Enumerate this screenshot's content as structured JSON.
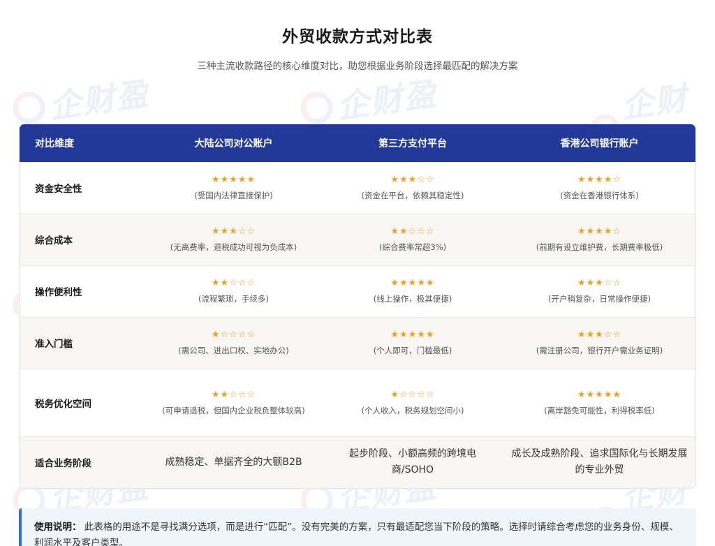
{
  "page": {
    "title": "外贸收款方式对比表",
    "subtitle": "三种主流收款路径的核心维度对比，助您根据业务阶段选择最匹配的解决方案",
    "watermark_text": "企财盈"
  },
  "table": {
    "headers": [
      "对比维度",
      "大陆公司对公账户",
      "第三方支付平台",
      "香港公司银行账户"
    ],
    "rows": [
      {
        "dimension": "资金安全性",
        "cells": [
          {
            "rating": 5,
            "stars": "★★★★★",
            "note": "(受国内法律直接保护)"
          },
          {
            "rating": 3,
            "stars": "★★★☆☆",
            "note": "(资金在平台，依赖其稳定性)"
          },
          {
            "rating": 4,
            "stars": "★★★★☆",
            "note": "(资金在香港银行体系)"
          }
        ]
      },
      {
        "dimension": "综合成本",
        "cells": [
          {
            "rating": 3,
            "stars": "★★★☆☆",
            "note": "(无高费率，退税成功可视为负成本)"
          },
          {
            "rating": 2,
            "stars": "★★☆☆☆",
            "note": "(综合费率常超3%)"
          },
          {
            "rating": 4,
            "stars": "★★★★☆",
            "note": "(前期有设立维护费，长期费率极低)"
          }
        ]
      },
      {
        "dimension": "操作便利性",
        "cells": [
          {
            "rating": 2,
            "stars": "★★☆☆☆",
            "note": "(流程繁琐，手续多)"
          },
          {
            "rating": 5,
            "stars": "★★★★★",
            "note": "(线上操作，极其便捷)"
          },
          {
            "rating": 3,
            "stars": "★★★☆☆",
            "note": "(开户稍复杂，日常操作便捷)"
          }
        ]
      },
      {
        "dimension": "准入门槛",
        "cells": [
          {
            "rating": 1,
            "stars": "★☆☆☆☆",
            "note": "(需公司、进出口权、实地办公)"
          },
          {
            "rating": 5,
            "stars": "★★★★★",
            "note": "(个人即可，门槛最低)"
          },
          {
            "rating": 3,
            "stars": "★★★☆☆",
            "note": "(需注册公司，银行开户需业务证明)"
          }
        ]
      },
      {
        "dimension": "税务优化空间",
        "cells": [
          {
            "rating": 2,
            "stars": "★★☆☆☆",
            "note": "(可申请退税，但国内企业税负整体较高)"
          },
          {
            "rating": 1,
            "stars": "★☆☆☆☆",
            "note": "(个人收入，税务规划空间小)"
          },
          {
            "rating": 5,
            "stars": "★★★★★",
            "note": "(离岸豁免可能性，利得税率低)"
          }
        ]
      }
    ],
    "stage_row": {
      "dimension": "适合业务阶段",
      "cells": [
        "成熟稳定、单据齐全的大额B2B",
        "起步阶段、小额高频的跨境电商/SOHO",
        "成长及成熟阶段、追求国际化与长期发展的专业外贸"
      ]
    }
  },
  "info": {
    "label": "使用说明：",
    "text": "此表格的用途不是寻找满分选项，而是进行“匹配”。没有完美的方案，只有最适配您当下阶段的策略。选择时请综合考虑您的业务身份、规模、利润水平及客户类型。"
  },
  "colors": {
    "header_bg": "#23399a",
    "star": "#f0a020",
    "info_accent": "#2f6fd6"
  }
}
